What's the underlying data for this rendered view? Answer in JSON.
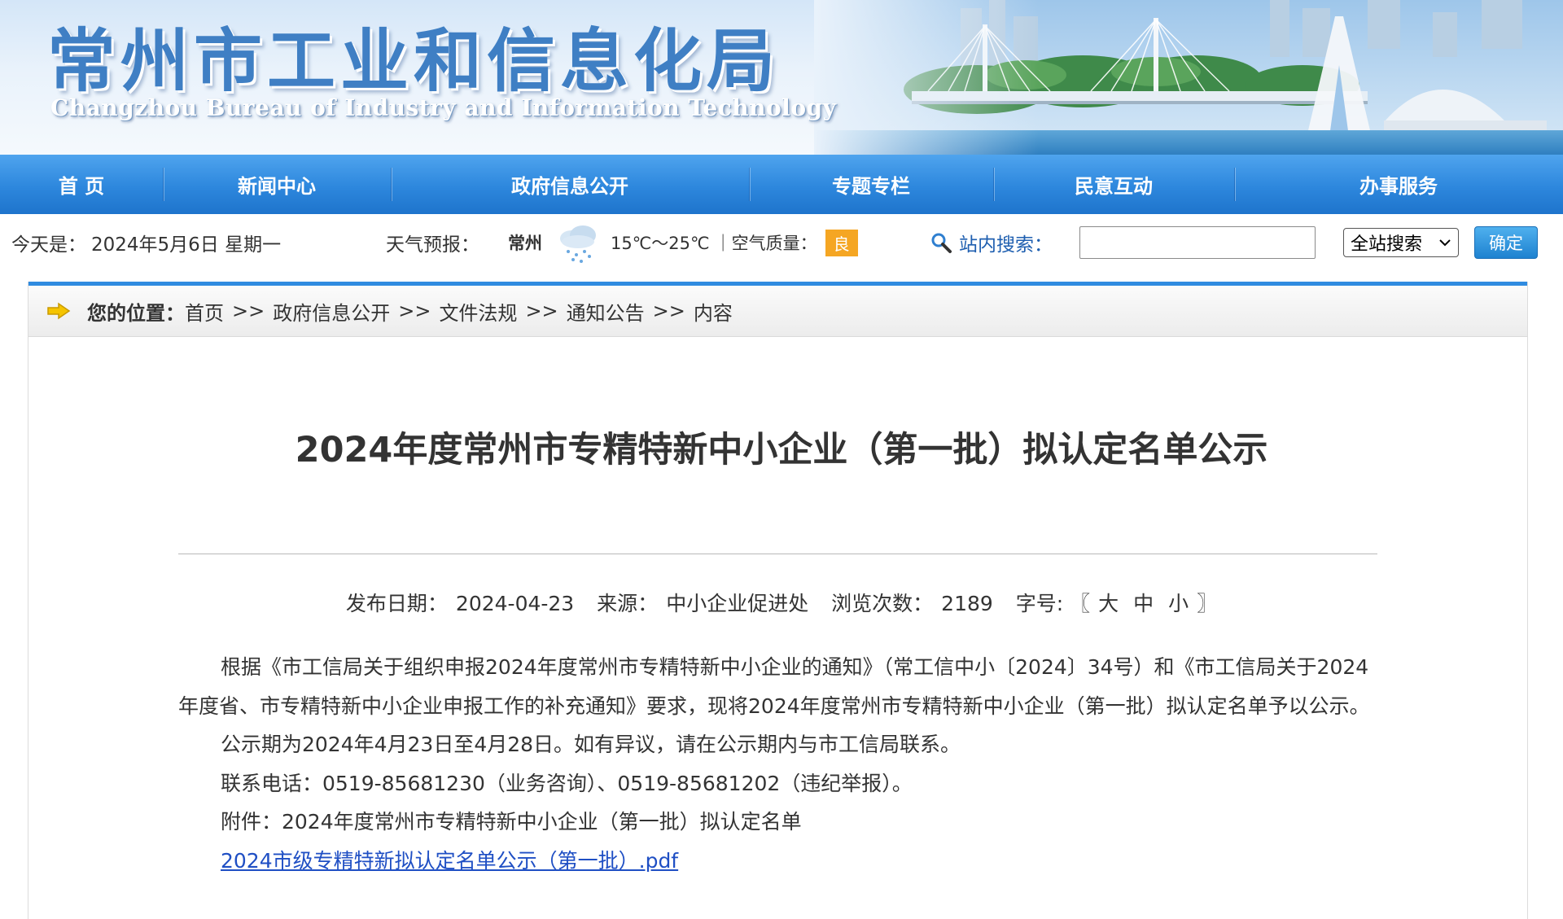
{
  "banner": {
    "title": "常州市工业和信息化局",
    "subtitle": "Changzhou Bureau of Industry and Information Technology"
  },
  "nav": {
    "items": [
      {
        "label": "首  页"
      },
      {
        "label": "新闻中心"
      },
      {
        "label": "政府信息公开"
      },
      {
        "label": "专题专栏"
      },
      {
        "label": "民意互动"
      },
      {
        "label": "办事服务"
      }
    ]
  },
  "infobar": {
    "today_label": "今天是：",
    "date": "2024年5月6日 星期一",
    "weather_label": "天气预报：",
    "city": "常州",
    "weather_icon": "rain-cloud-icon",
    "temperature": "15℃～25℃",
    "air_label": "｜空气质量：",
    "air_quality": "良",
    "air_badge_color": "#f5a623",
    "search_label": "站内搜索：",
    "search_value": "",
    "scope_selected": "全站搜索",
    "confirm_label": "确定"
  },
  "breadcrumb": {
    "label": "您的位置：",
    "items": [
      "首页",
      "政府信息公开",
      "文件法规",
      "通知公告",
      "内容"
    ],
    "separator": ">>"
  },
  "article": {
    "title": "2024年度常州市专精特新中小企业（第一批）拟认定名单公示",
    "meta": {
      "date_label": "发布日期：",
      "date": "2024-04-23",
      "source_label": "来源：",
      "source": "中小企业促进处",
      "views_label": "浏览次数：",
      "views": "2189",
      "font_label": "字号: 〖",
      "size_large": "大",
      "size_medium": "中",
      "size_small": "小",
      "font_close": "〗"
    },
    "paragraphs": [
      "根据《市工信局关于组织申报2024年度常州市专精特新中小企业的通知》（常工信中小〔2024〕34号）和《市工信局关于2024年度省、市专精特新中小企业申报工作的补充通知》要求，现将2024年度常州市专精特新中小企业（第一批）拟认定名单予以公示。",
      "公示期为2024年4月23日至4月28日。如有异议，请在公示期内与市工信局联系。",
      "联系电话：0519-85681230（业务咨询）、0519-85681202（违纪举报）。",
      "附件：2024年度常州市专精特新中小企业（第一批）拟认定名单"
    ],
    "attachment_link": "2024市级专精特新拟认定名单公示（第一批）.pdf",
    "link_color": "#1f4fc4"
  }
}
